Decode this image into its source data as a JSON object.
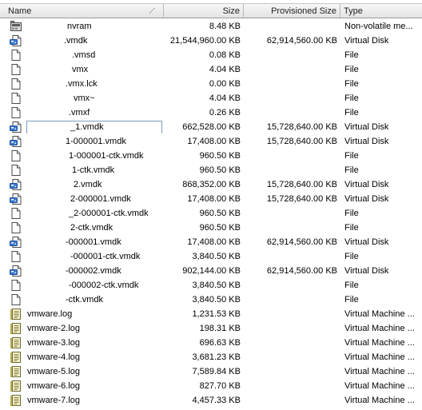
{
  "header": {
    "name": "Name",
    "size": "Size",
    "provisioned": "Provisioned Size",
    "type": "Type"
  },
  "files": [
    {
      "name": "nvram",
      "icon": "nvram-icon",
      "size": "8.48 KB",
      "provisioned": "",
      "type": "Non-volatile me..."
    },
    {
      "name": ".vmdk",
      "icon": "virtual-disk-icon",
      "size": "21,544,960.00 KB",
      "provisioned": "62,914,560.00 KB",
      "type": "Virtual Disk"
    },
    {
      "name": ".vmsd",
      "icon": "file-icon",
      "size": "0.08 KB",
      "provisioned": "",
      "type": "File"
    },
    {
      "name": "vmx",
      "icon": "file-icon",
      "size": "4.04 KB",
      "provisioned": "",
      "type": "File"
    },
    {
      "name": ".vmx.lck",
      "icon": "file-icon",
      "size": "0.00 KB",
      "provisioned": "",
      "type": "File"
    },
    {
      "name": "vmx~",
      "icon": "file-icon",
      "size": "4.04 KB",
      "provisioned": "",
      "type": "File"
    },
    {
      "name": ".vmxf",
      "icon": "file-icon",
      "size": "0.26 KB",
      "provisioned": "",
      "type": "File"
    },
    {
      "name": "_1.vmdk",
      "icon": "virtual-disk-icon",
      "size": "662,528.00 KB",
      "provisioned": "15,728,640.00 KB",
      "type": "Virtual Disk"
    },
    {
      "name": "1-000001.vmdk",
      "icon": "virtual-disk-icon",
      "size": "17,408.00 KB",
      "provisioned": "15,728,640.00 KB",
      "type": "Virtual Disk"
    },
    {
      "name": "1-000001-ctk.vmdk",
      "icon": "file-icon",
      "size": "960.50 KB",
      "provisioned": "",
      "type": "File"
    },
    {
      "name": "1-ctk.vmdk",
      "icon": "file-icon",
      "size": "960.50 KB",
      "provisioned": "",
      "type": "File"
    },
    {
      "name": "2.vmdk",
      "icon": "virtual-disk-icon",
      "size": "868,352.00 KB",
      "provisioned": "15,728,640.00 KB",
      "type": "Virtual Disk"
    },
    {
      "name": "2-000001.vmdk",
      "icon": "virtual-disk-icon",
      "size": "17,408.00 KB",
      "provisioned": "15,728,640.00 KB",
      "type": "Virtual Disk"
    },
    {
      "name": "_2-000001-ctk.vmdk",
      "icon": "file-icon",
      "size": "960.50 KB",
      "provisioned": "",
      "type": "File"
    },
    {
      "name": "2-ctk.vmdk",
      "icon": "file-icon",
      "size": "960.50 KB",
      "provisioned": "",
      "type": "File"
    },
    {
      "name": "-000001.vmdk",
      "icon": "virtual-disk-icon",
      "size": "17,408.00 KB",
      "provisioned": "62,914,560.00 KB",
      "type": "Virtual Disk"
    },
    {
      "name": "-000001-ctk.vmdk",
      "icon": "file-icon",
      "size": "3,840.50 KB",
      "provisioned": "",
      "type": "File"
    },
    {
      "name": "-000002.vmdk",
      "icon": "virtual-disk-icon",
      "size": "902,144.00 KB",
      "provisioned": "62,914,560.00 KB",
      "type": "Virtual Disk"
    },
    {
      "name": "-000002-ctk.vmdk",
      "icon": "file-icon",
      "size": "3,840.50 KB",
      "provisioned": "",
      "type": "File"
    },
    {
      "name": "-ctk.vmdk",
      "icon": "file-icon",
      "size": "3,840.50 KB",
      "provisioned": "",
      "type": "File"
    },
    {
      "name": "vmware.log",
      "icon": "log-file-icon",
      "size": "1,231.53 KB",
      "provisioned": "",
      "type": "Virtual Machine ..."
    },
    {
      "name": "vmware-2.log",
      "icon": "log-file-icon",
      "size": "198.31 KB",
      "provisioned": "",
      "type": "Virtual Machine ..."
    },
    {
      "name": "vmware-3.log",
      "icon": "log-file-icon",
      "size": "696.63 KB",
      "provisioned": "",
      "type": "Virtual Machine ..."
    },
    {
      "name": "vmware-4.log",
      "icon": "log-file-icon",
      "size": "3,681.23 KB",
      "provisioned": "",
      "type": "Virtual Machine ..."
    },
    {
      "name": "vmware-5.log",
      "icon": "log-file-icon",
      "size": "7,589.84 KB",
      "provisioned": "",
      "type": "Virtual Machine ..."
    },
    {
      "name": "vmware-6.log",
      "icon": "log-file-icon",
      "size": "827.70 KB",
      "provisioned": "",
      "type": "Virtual Machine ..."
    },
    {
      "name": "vmware-7.log",
      "icon": "log-file-icon",
      "size": "4,457.33 KB",
      "provisioned": "",
      "type": "Virtual Machine ..."
    }
  ]
}
